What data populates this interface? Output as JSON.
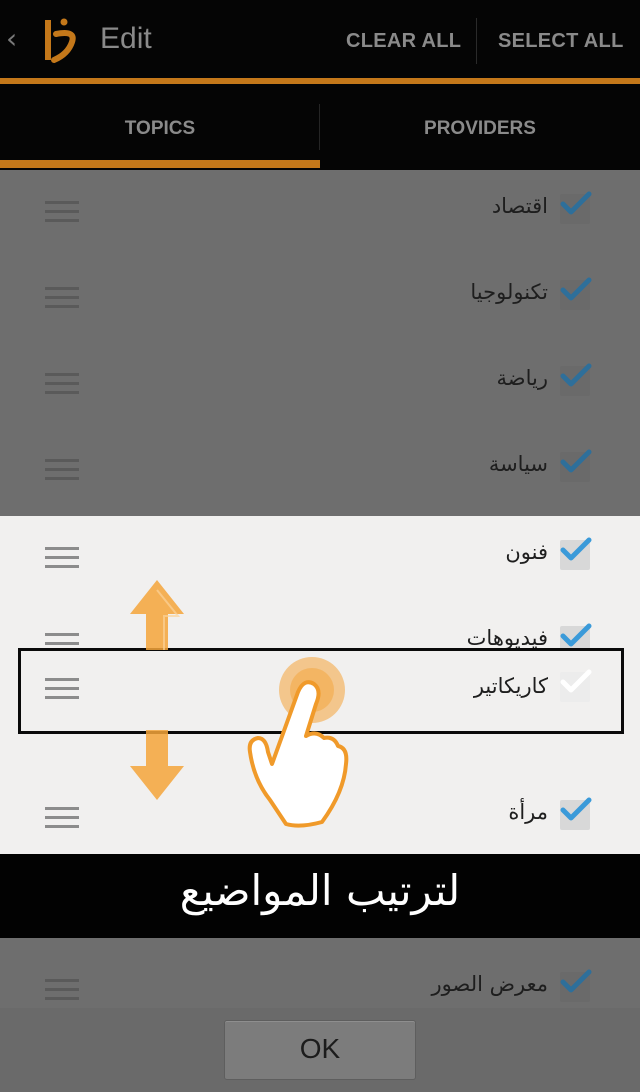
{
  "header": {
    "back_glyph": "‹",
    "title": "Edit",
    "clear_all": "CLEAR ALL",
    "select_all": "SELECT ALL"
  },
  "tabs": [
    {
      "label": "TOPICS",
      "selected": true
    },
    {
      "label": "PROVIDERS",
      "selected": false
    }
  ],
  "topics": [
    {
      "label": "اقتصاد",
      "checked": true
    },
    {
      "label": "تكنولوجيا",
      "checked": true
    },
    {
      "label": "رياضة",
      "checked": true
    },
    {
      "label": "سياسة",
      "checked": true
    },
    {
      "label": "فنون",
      "checked": true
    },
    {
      "label": "فيديوهات",
      "checked": true
    },
    {
      "label": "كاريكاتير",
      "checked": false,
      "dragging": true
    },
    {
      "label": "مرأة",
      "checked": true
    },
    {
      "label": "معرض الصور",
      "checked": true
    }
  ],
  "overlay": {
    "banner_text": "لترتيب المواضيع"
  },
  "footer": {
    "ok_label": "OK"
  },
  "colors": {
    "accent_orange": "#c4781a",
    "check_blue": "#3a9ad9",
    "arrow_orange": "#f4a43a"
  },
  "icons": [
    "back-chevron-icon",
    "app-logo-icon",
    "drag-handle-icon",
    "checkmark-icon",
    "up-arrow-icon",
    "down-arrow-icon",
    "pointing-hand-icon"
  ]
}
